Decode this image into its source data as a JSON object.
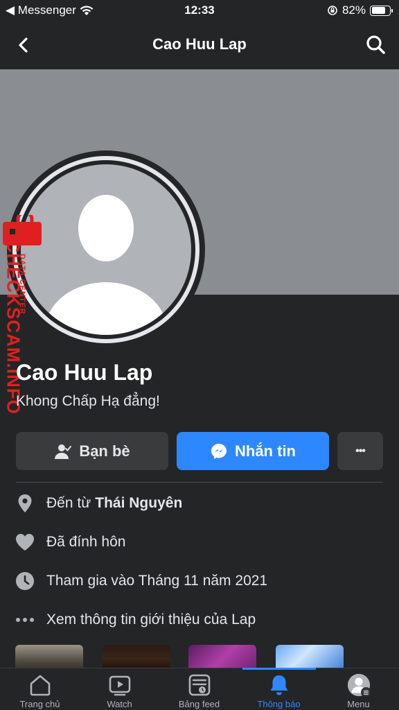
{
  "status_bar": {
    "carrier": "◀ Messenger",
    "time": "12:33",
    "battery_text": "82%",
    "battery_level": 0.82
  },
  "header": {
    "title": "Cao Huu Lap"
  },
  "profile": {
    "name": "Cao Huu Lap",
    "bio": "Khong Chấp Hạ đẳng!"
  },
  "watermark": {
    "line1": "DATA CENTER",
    "line2": "CHECKSCAM.INFO"
  },
  "actions": {
    "friends_label": "Bạn bè",
    "message_label": "Nhắn tin",
    "more_label": "•••"
  },
  "info": {
    "from_prefix": "Đến từ",
    "from_place": "Thái Nguyên",
    "relationship": "Đã đính hôn",
    "joined": "Tham gia vào Tháng 11 năm 2021",
    "see_about": "Xem thông tin giới thiệu của Lap"
  },
  "bottom_nav": [
    {
      "label": "Trang chủ",
      "icon": "home-icon"
    },
    {
      "label": "Watch",
      "icon": "watch-icon"
    },
    {
      "label": "Bảng feed",
      "icon": "feed-icon"
    },
    {
      "label": "Thông báo",
      "icon": "bell-icon",
      "active": true
    },
    {
      "label": "Menu",
      "icon": "menu-avatar-icon"
    }
  ],
  "colors": {
    "background": "#242526",
    "cover": "#8a8d91",
    "accent": "#2d88ff",
    "button_secondary": "#3a3b3c",
    "watermark": "#e02020"
  }
}
